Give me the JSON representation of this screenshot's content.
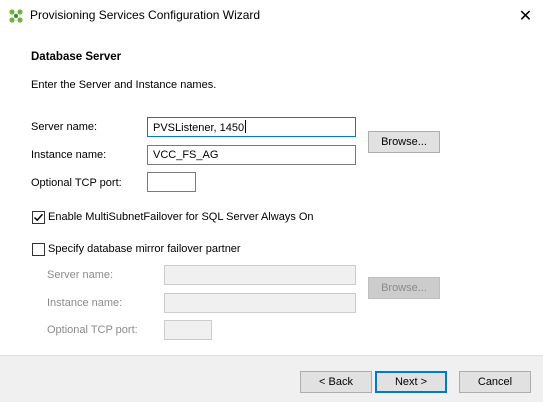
{
  "window": {
    "title": "Provisioning Services Configuration Wizard",
    "close_glyph": "✕",
    "icon": "citrix-logo-icon"
  },
  "section": {
    "title": "Database Server",
    "description": "Enter the Server and Instance names."
  },
  "primary": {
    "server_label": "Server name:",
    "server_value": "PVSListener, 1450",
    "instance_label": "Instance name:",
    "instance_value": "VCC_FS_AG",
    "port_label": "Optional TCP port:",
    "port_value": "",
    "browse_label": "Browse..."
  },
  "multisubnet": {
    "label": "Enable MultiSubnetFailover for SQL Server Always On",
    "checked": true
  },
  "mirror": {
    "label": "Specify database mirror failover partner",
    "checked": false,
    "server_label": "Server name:",
    "instance_label": "Instance name:",
    "port_label": "Optional TCP port:",
    "browse_label": "Browse..."
  },
  "footer": {
    "back_label": "< Back",
    "next_label": "Next >",
    "cancel_label": "Cancel"
  },
  "colors": {
    "accent": "#0078d7",
    "footer_bg": "#f0f0f0",
    "disabled_text": "#8b8b8b"
  }
}
